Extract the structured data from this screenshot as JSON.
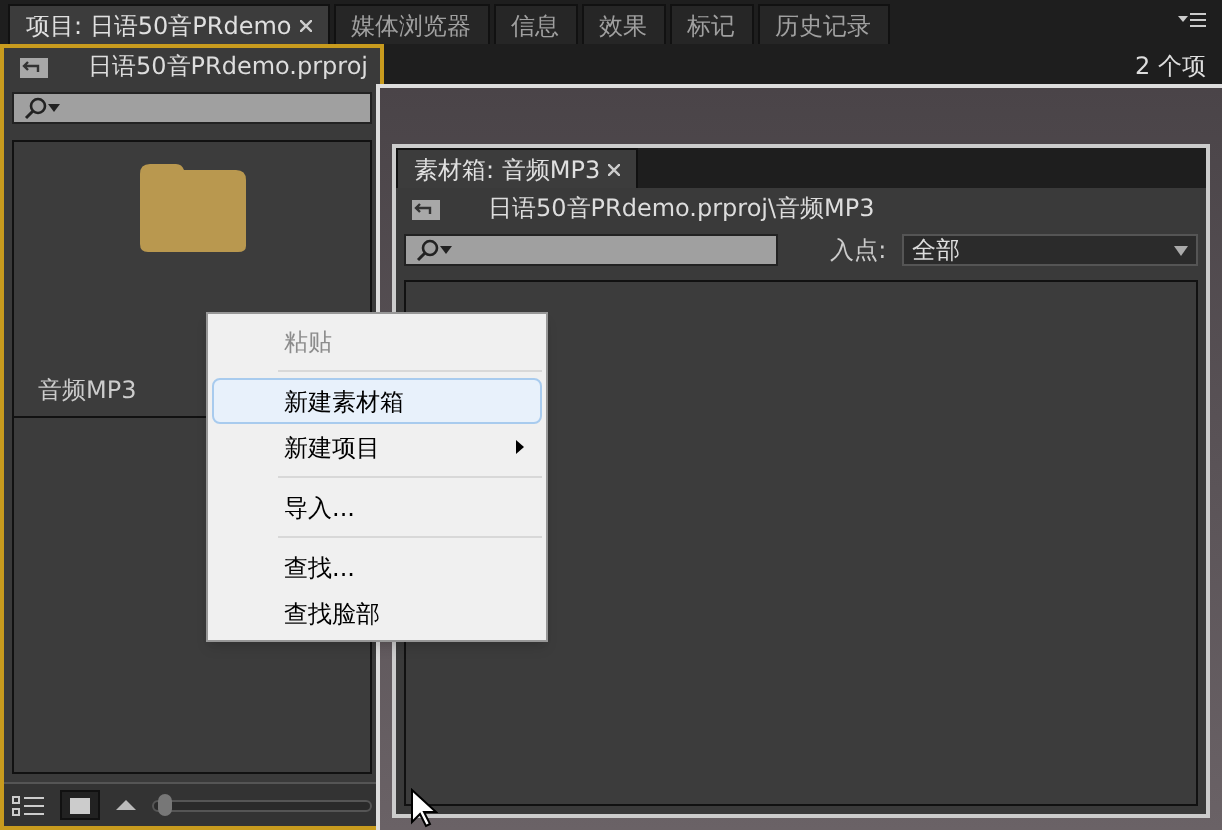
{
  "project_panel": {
    "tabs": [
      {
        "label": "项目: 日语50音PRdemo",
        "selected": true,
        "closable": true
      },
      {
        "label": "媒体浏览器",
        "selected": false,
        "closable": false
      },
      {
        "label": "信息",
        "selected": false,
        "closable": false
      },
      {
        "label": "效果",
        "selected": false,
        "closable": false
      },
      {
        "label": "标记",
        "selected": false,
        "closable": false
      },
      {
        "label": "历史记录",
        "selected": false,
        "closable": false
      }
    ],
    "path": "日语50音PRdemo.prproj",
    "item_count": "2 个项",
    "bins": [
      {
        "name": "音频MP3"
      }
    ],
    "zoom_slider": {
      "level": 0.02
    }
  },
  "bin_window": {
    "tab": {
      "label": "素材箱: 音频MP3",
      "selected": true,
      "closable": true
    },
    "path": "日语50音PRdemo.prproj\\音频MP3",
    "in_point_label": "入点:",
    "in_point_value": "全部"
  },
  "context_menu": {
    "items": [
      {
        "kind": "item",
        "label": "粘贴",
        "disabled": true,
        "selected": false,
        "submenu": false
      },
      {
        "kind": "separator"
      },
      {
        "kind": "item",
        "label": "新建素材箱",
        "disabled": false,
        "selected": true,
        "submenu": false
      },
      {
        "kind": "item",
        "label": "新建项目",
        "disabled": false,
        "selected": false,
        "submenu": true
      },
      {
        "kind": "separator"
      },
      {
        "kind": "item",
        "label": "导入...",
        "disabled": false,
        "selected": false,
        "submenu": false
      },
      {
        "kind": "separator"
      },
      {
        "kind": "item",
        "label": "查找...",
        "disabled": false,
        "selected": false,
        "submenu": false
      },
      {
        "kind": "item",
        "label": "查找脸部",
        "disabled": false,
        "selected": false,
        "submenu": false
      }
    ]
  }
}
